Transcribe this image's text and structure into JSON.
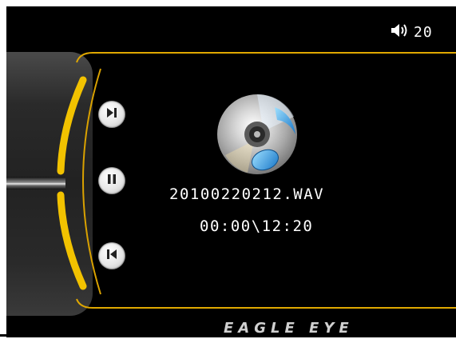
{
  "status_bar": {
    "volume_icon": "speaker-icon",
    "volume_level": "20"
  },
  "player": {
    "file_name": "20100220212.WAV",
    "time": "00:00\\12:20"
  },
  "controls": {
    "next_icon": "skip-next-icon",
    "pause_icon": "pause-icon",
    "prev_icon": "skip-previous-icon"
  },
  "brand": "EAGLE EYE",
  "colors": {
    "accent": "#f2c200",
    "background": "#000000",
    "rail": "#2a2a2a"
  }
}
